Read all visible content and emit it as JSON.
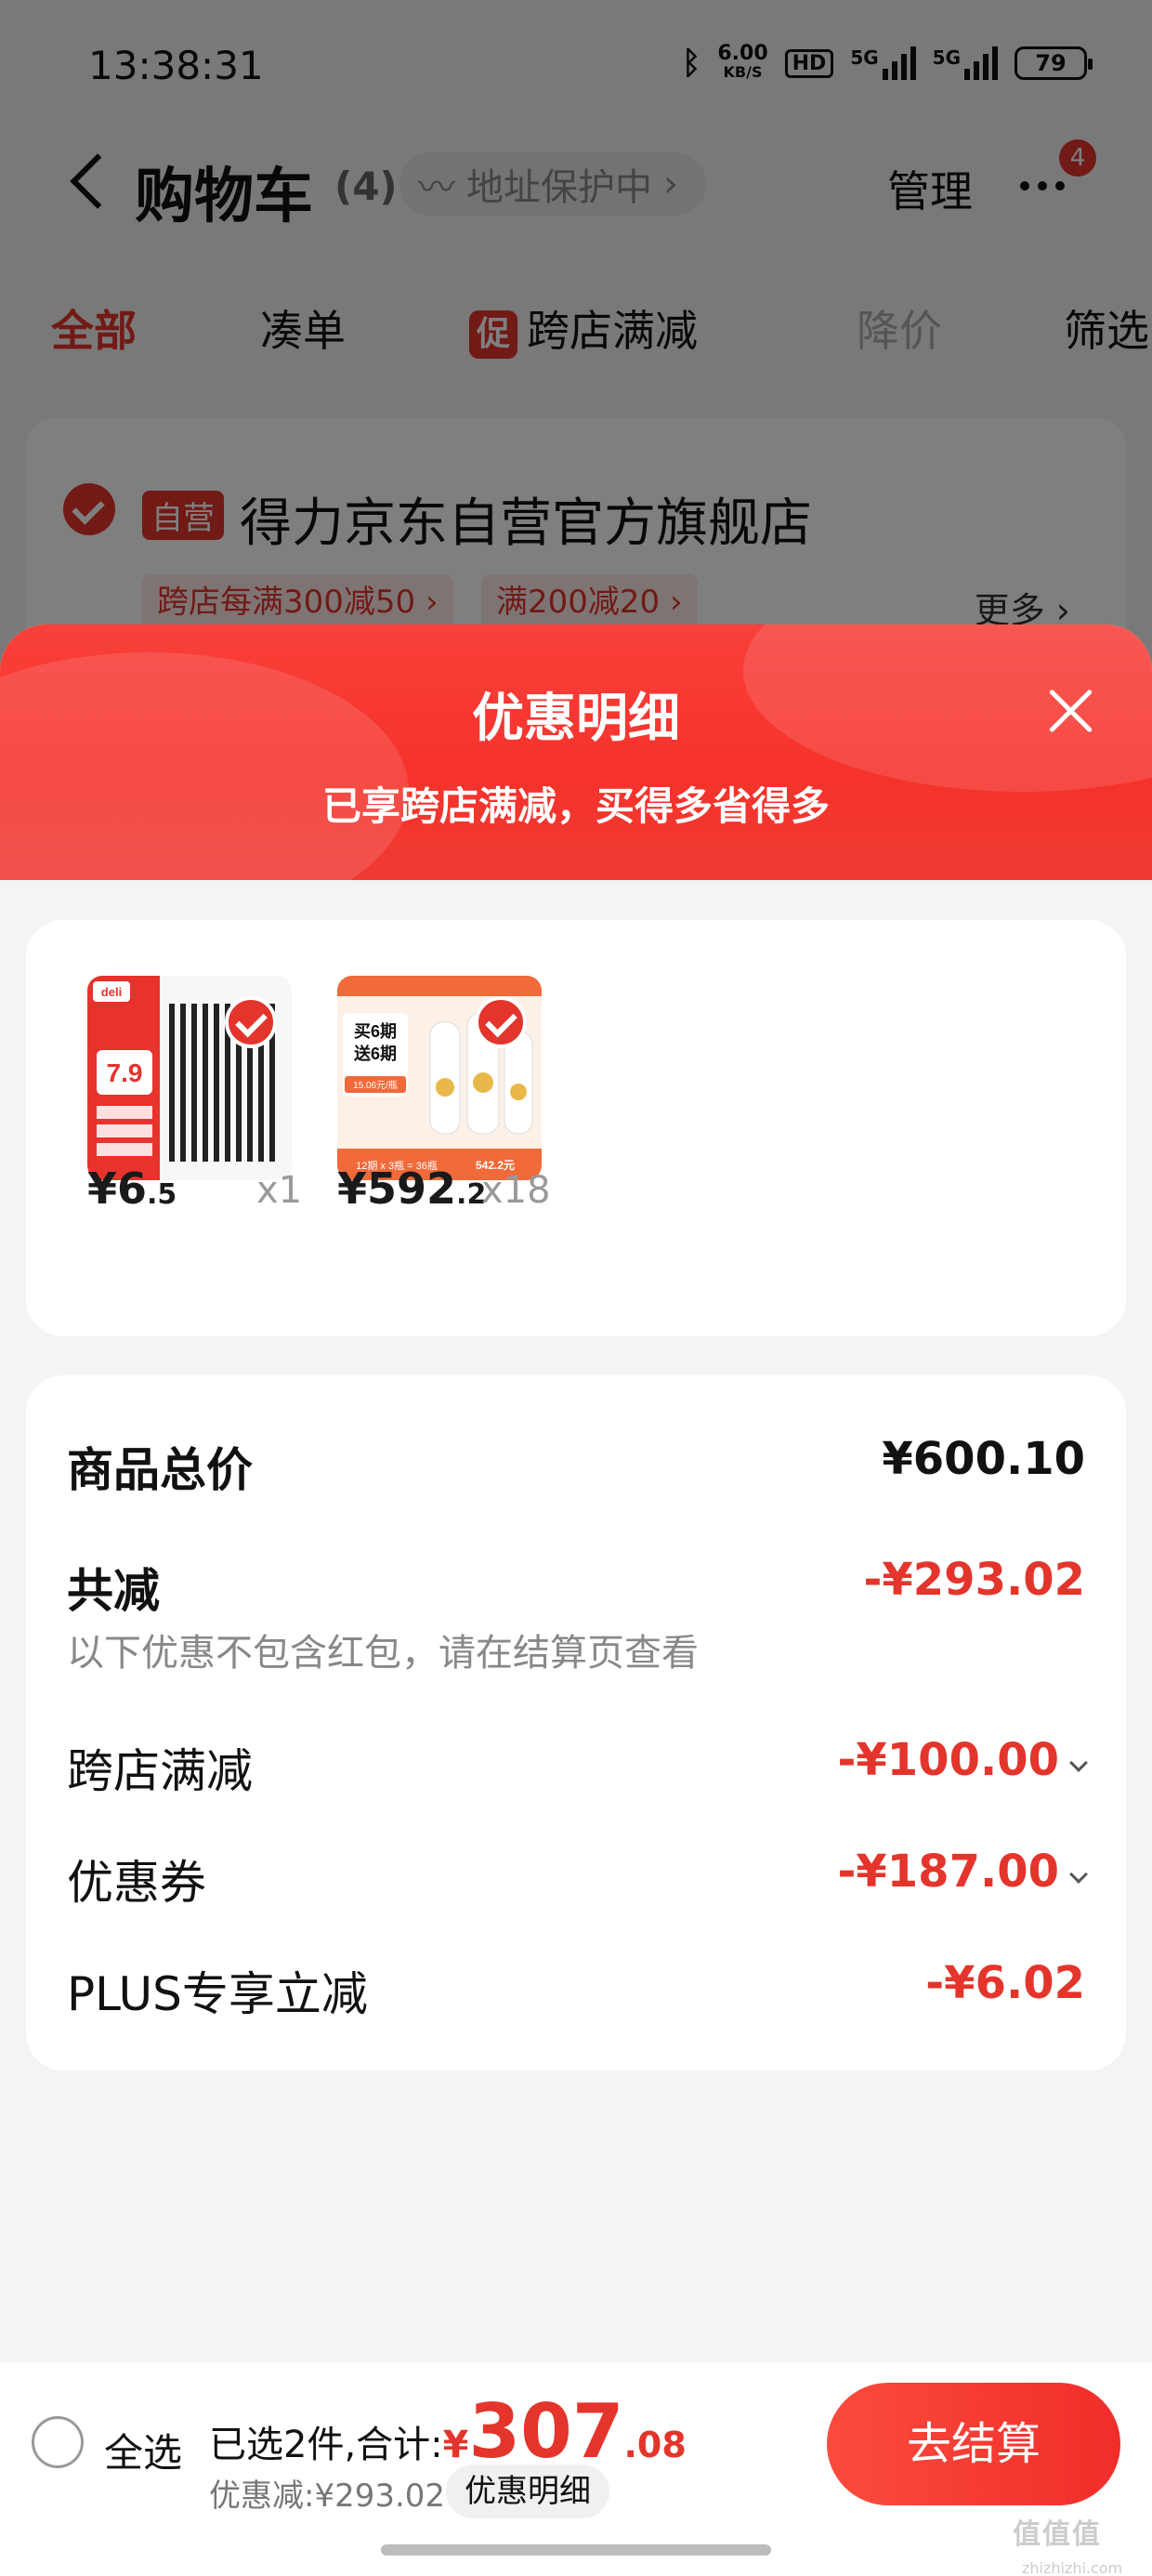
{
  "status_bar": {
    "time": "13:38:31",
    "net_speed": "6.00",
    "net_unit": "KB/S",
    "hd": "HD",
    "signal1": "5G",
    "signal2": "5G",
    "battery": "79"
  },
  "header": {
    "title": "购物车",
    "count": "(4)",
    "address_protection": "地址保护中",
    "manage": "管理",
    "more_badge": "4"
  },
  "filter_tabs": [
    {
      "label": "全部"
    },
    {
      "label": "凑单"
    },
    {
      "label": "跨店满减",
      "tag": "促"
    },
    {
      "label": "降价"
    },
    {
      "label": "筛选"
    }
  ],
  "store": {
    "badge": "自营",
    "name": "得力京东自营官方旗舰店",
    "promos": [
      "跨店每满300减50 ›",
      "满200减20 ›"
    ],
    "more": "更多 ›"
  },
  "sheet": {
    "title": "优惠明细",
    "subtitle": "已享跨店满减，买得多省得多",
    "products": [
      {
        "yen": "¥",
        "price_int": "6",
        "price_dec": ".5",
        "qty": "x1"
      },
      {
        "yen": "¥",
        "price_int": "592",
        "price_dec": ".2",
        "qty": "x18"
      }
    ],
    "product1_art": {
      "brand": "deli",
      "price": "7.9"
    },
    "product2_art": {
      "line1": "买6期",
      "line2": "送6期",
      "tag": "15.06元/瓶",
      "foot1": "12期 x 3瓶 = 36瓶",
      "foot2": "542.2元"
    },
    "summary": {
      "total_label": "商品总价",
      "total_value": "¥600.10",
      "discount_label": "共减",
      "discount_value": "-¥293.02",
      "note": "以下优惠不包含红包，请在结算页查看",
      "rows": [
        {
          "label": "跨店满减",
          "value": "-¥100.00",
          "expandable": true
        },
        {
          "label": "优惠券",
          "value": "-¥187.00",
          "expandable": true
        },
        {
          "label": "PLUS专享立减",
          "value": "-¥6.02",
          "expandable": false
        }
      ]
    }
  },
  "bottom_bar": {
    "select_all": "全选",
    "selected_text": "已选2件,合计:",
    "yen": "¥",
    "total_int": "307",
    "total_dec": ".08",
    "discount_text": "优惠减:¥293.02",
    "detail_button": "优惠明细",
    "checkout": "去结算"
  },
  "watermark": {
    "main": "值值值",
    "sub": "zhizhizhi.com"
  },
  "colors": {
    "accent": "#e3352c",
    "sheet_header": "#f5322b"
  }
}
